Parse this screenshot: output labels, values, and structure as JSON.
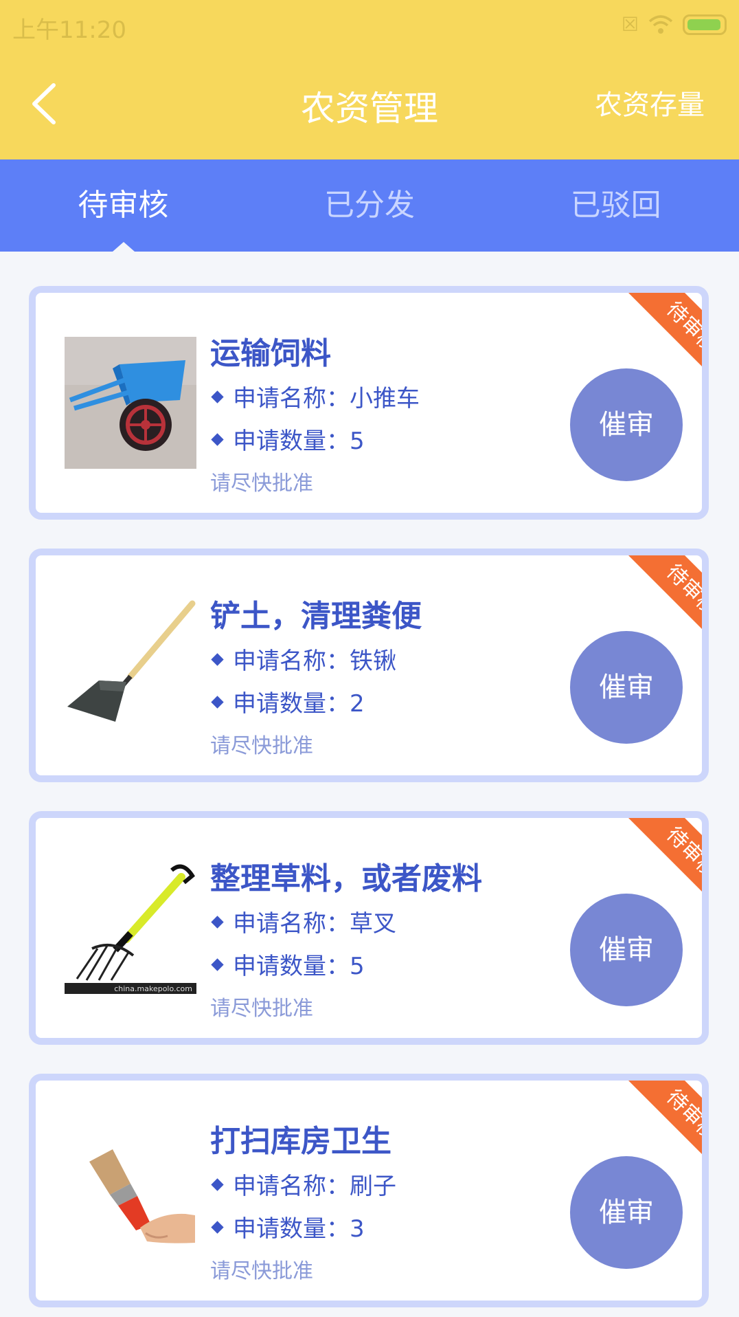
{
  "status_bar": {
    "time": "上午11:20"
  },
  "header": {
    "title": "农资管理",
    "action": "农资存量"
  },
  "tabs": [
    {
      "label": "待审核",
      "active": true
    },
    {
      "label": "已分发",
      "active": false
    },
    {
      "label": "已驳回",
      "active": false
    }
  ],
  "cards": [
    {
      "title": "运输饲料",
      "name_line": "申请名称：小推车",
      "qty_line": "申请数量：5",
      "note": "请尽快批准",
      "button": "催审",
      "ribbon": "待审核",
      "image": "wheelbarrow"
    },
    {
      "title": "铲土，清理粪便",
      "name_line": "申请名称：铁锹",
      "qty_line": "申请数量：2",
      "note": "请尽快批准",
      "button": "催审",
      "ribbon": "待审核",
      "image": "shovel"
    },
    {
      "title": "整理草料，或者废料",
      "name_line": "申请名称：草叉",
      "qty_line": "申请数量：5",
      "note": "请尽快批准",
      "button": "催审",
      "ribbon": "待审核",
      "image": "pitchfork",
      "image_watermark": "china.makepolo.com"
    },
    {
      "title": "打扫库房卫生",
      "name_line": "申请名称：刷子",
      "qty_line": "申请数量：3",
      "note": "请尽快批准",
      "button": "催审",
      "ribbon": "待审核",
      "image": "brush"
    }
  ],
  "colors": {
    "header": "#f7d85c",
    "tabs": "#5d7ff7",
    "card_border": "#cdd6fb",
    "ribbon": "#f46f33",
    "button": "#7887d4",
    "text": "#3c56c7"
  }
}
